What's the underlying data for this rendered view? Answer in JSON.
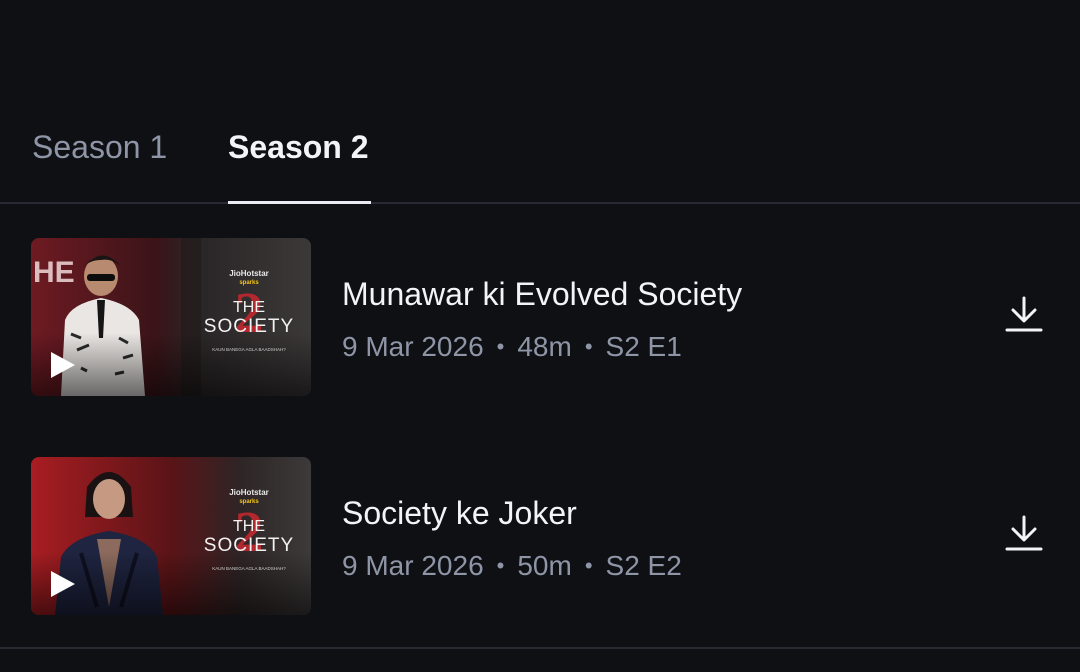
{
  "tabs": [
    {
      "label": "Season 1",
      "selected": false
    },
    {
      "label": "Season 2",
      "selected": true
    }
  ],
  "episodes": [
    {
      "title": "Munawar ki Evolved Society",
      "date": "9 Mar 2026",
      "duration": "48m",
      "episode": "S2 E1",
      "thumbnail": {
        "brand_top": "JioHotstar",
        "brand_sub": "sparks",
        "show_line1": "THE",
        "show_line2": "SOCIETY",
        "season_numeral": "2",
        "tagline": "KAUN BANEGA AGLA BAADSHAH?",
        "corner_text": "HE"
      }
    },
    {
      "title": "Society ke Joker",
      "date": "9 Mar 2026",
      "duration": "50m",
      "episode": "S2 E2",
      "thumbnail": {
        "brand_top": "JioHotstar",
        "brand_sub": "sparks",
        "show_line1": "THE",
        "show_line2": "SOCIETY",
        "season_numeral": "2",
        "tagline": "KAUN BANEGA AGLA BAADSHAH?"
      }
    }
  ],
  "meta_separator": "•",
  "colors": {
    "background": "#0f1014",
    "text_primary": "#f2f4f8",
    "text_secondary": "#8e95a6",
    "divider": "#272a33",
    "accent_red": "#c0282e"
  },
  "icons": {
    "play": "play-icon",
    "download": "download-icon"
  }
}
